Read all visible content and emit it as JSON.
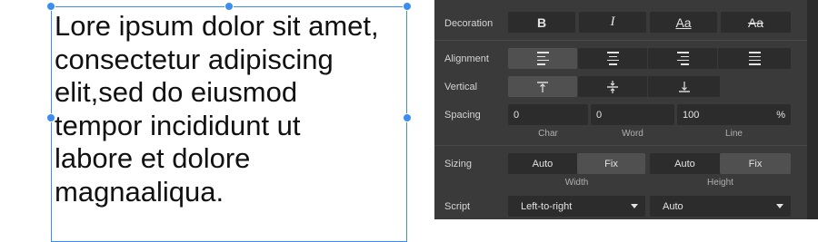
{
  "canvas": {
    "text": "Lore ipsum dolor sit amet,\nconsectetur adipiscing\nelit,sed do eiusmod\ntempor incididunt ut\nlabore et dolore\nmagnaaliqua."
  },
  "panel": {
    "decoration": {
      "label": "Decoration",
      "bold": "B",
      "italic": "I",
      "underline": "Aa",
      "strikethrough": "Aa"
    },
    "alignment": {
      "label": "Alignment"
    },
    "vertical": {
      "label": "Vertical"
    },
    "spacing": {
      "label": "Spacing",
      "char_value": "0",
      "word_value": "0",
      "line_value": "100",
      "line_unit": "%",
      "char_label": "Char",
      "word_label": "Word",
      "line_label": "Line"
    },
    "sizing": {
      "label": "Sizing",
      "width_auto": "Auto",
      "width_fix": "Fix",
      "height_auto": "Auto",
      "height_fix": "Fix",
      "width_label": "Width",
      "height_label": "Height"
    },
    "script": {
      "label": "Script",
      "direction": "Left-to-right",
      "language": "Auto"
    }
  }
}
